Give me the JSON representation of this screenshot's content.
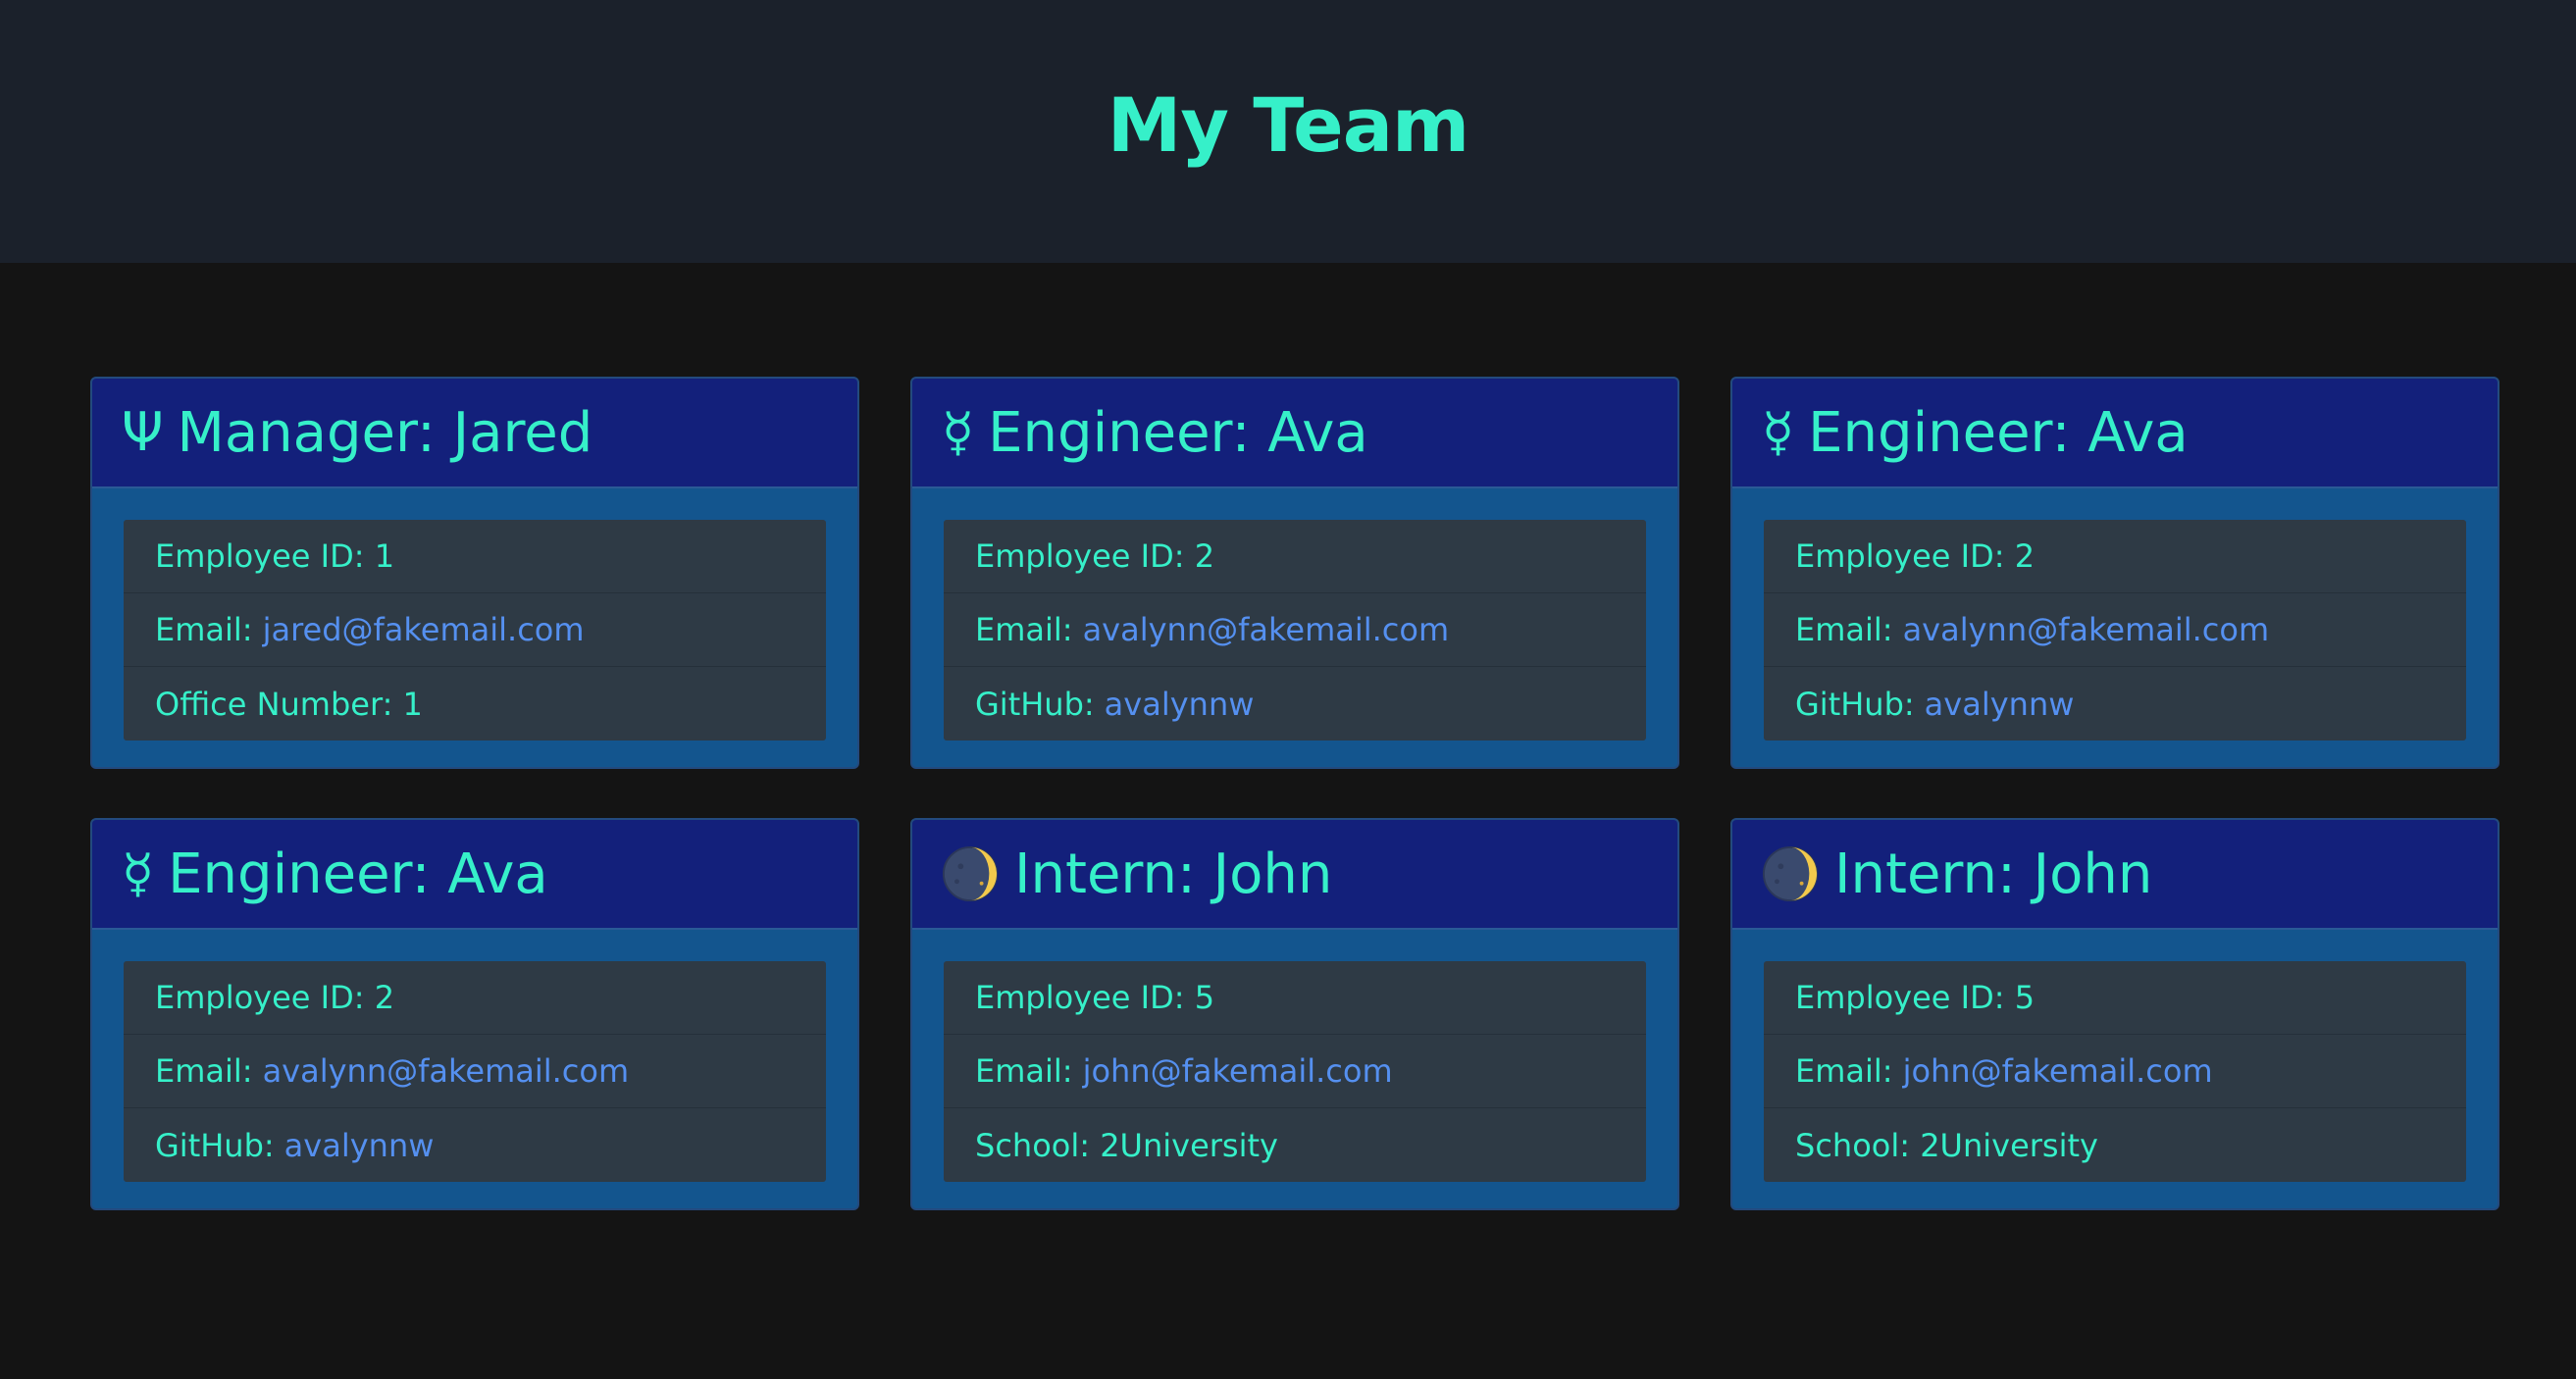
{
  "page": {
    "title": "My Team"
  },
  "colors": {
    "header_bg": "#1b212b",
    "page_bg": "#141414",
    "accent_text": "#36f0c9",
    "link": "#5590f0",
    "card_head_bg": "#13207b",
    "card_body_bg": "#13558e",
    "list_bg": "#2e3a45"
  },
  "cards": [
    {
      "icon": "trident-icon",
      "icon_glyph": "Ψ",
      "title": "Manager: Jared",
      "id_text": "Employee ID: 1",
      "email_label": "Email:",
      "email": "jared@fakemail.com",
      "extra_label": "Office Number: 1",
      "extra_value": ""
    },
    {
      "icon": "mercury-icon",
      "icon_glyph": "☿",
      "title": "Engineer: Ava",
      "id_text": "Employee ID: 2",
      "email_label": "Email:",
      "email": "avalynn@fakemail.com",
      "extra_label": "GitHub:",
      "extra_value": "avalynnw"
    },
    {
      "icon": "mercury-icon",
      "icon_glyph": "☿",
      "title": "Engineer: Ava",
      "id_text": "Employee ID: 2",
      "email_label": "Email:",
      "email": "avalynn@fakemail.com",
      "extra_label": "GitHub:",
      "extra_value": "avalynnw"
    },
    {
      "icon": "mercury-icon",
      "icon_glyph": "☿",
      "title": "Engineer: Ava",
      "id_text": "Employee ID: 2",
      "email_label": "Email:",
      "email": "avalynn@fakemail.com",
      "extra_label": "GitHub:",
      "extra_value": "avalynnw"
    },
    {
      "icon": "moon-icon",
      "icon_glyph": "",
      "title": "Intern: John",
      "id_text": "Employee ID: 5",
      "email_label": "Email:",
      "email": "john@fakemail.com",
      "extra_label": "School: 2University",
      "extra_value": ""
    },
    {
      "icon": "moon-icon",
      "icon_glyph": "",
      "title": "Intern: John",
      "id_text": "Employee ID: 5",
      "email_label": "Email:",
      "email": "john@fakemail.com",
      "extra_label": "School: 2University",
      "extra_value": ""
    }
  ]
}
